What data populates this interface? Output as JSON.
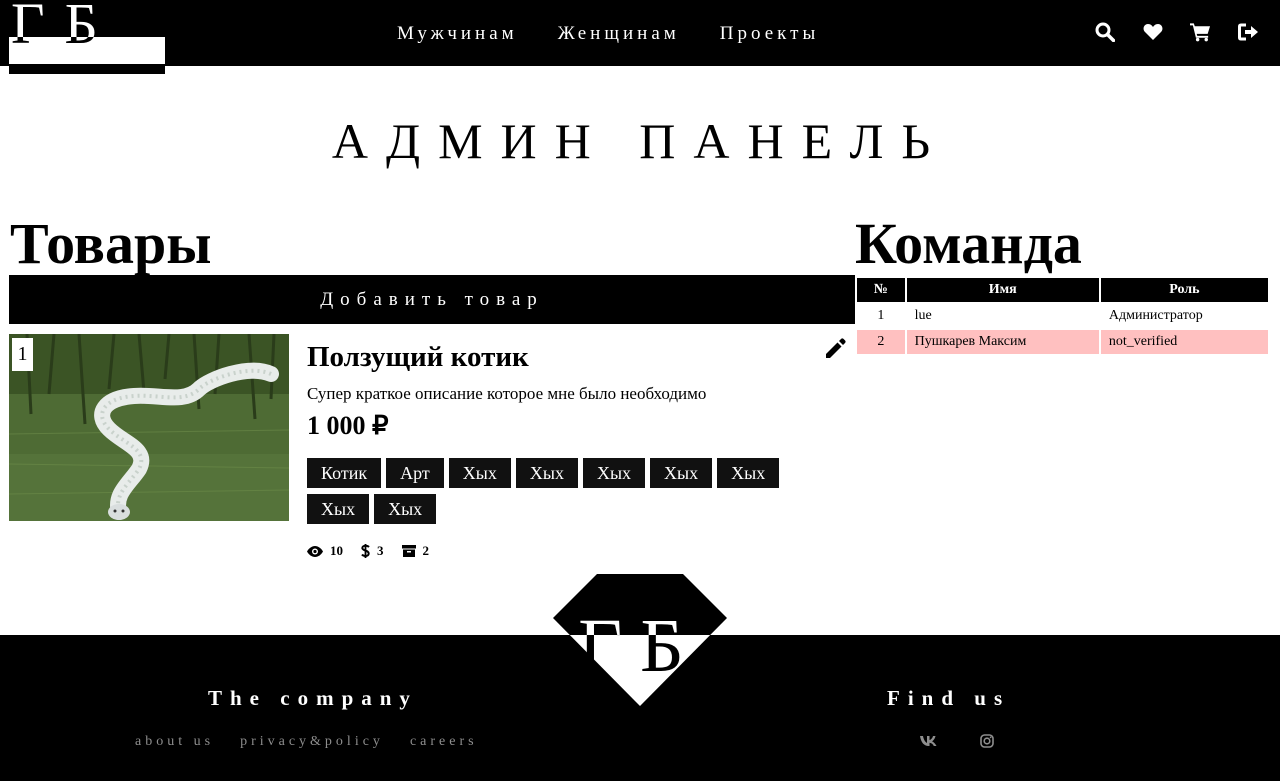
{
  "header": {
    "logo_text": "ГБ",
    "nav": [
      {
        "label": "Мужчинам"
      },
      {
        "label": "Женщинам"
      },
      {
        "label": "Проекты"
      }
    ],
    "icons": [
      "search-icon",
      "heart-icon",
      "cart-icon",
      "logout-icon"
    ]
  },
  "page": {
    "title": "АДМИН ПАНЕЛЬ"
  },
  "products": {
    "heading": "Товары",
    "add_button": "Добавить товар",
    "items": [
      {
        "index": "1",
        "name": "Ползущий котик",
        "description": "Супер краткое описание которое мне было необходимо",
        "price": "1 000 ₽",
        "tags": [
          "Котик",
          "Арт",
          "Хых",
          "Хых",
          "Хых",
          "Хых",
          "Хых",
          "Хых",
          "Хых"
        ],
        "stats": {
          "views": "10",
          "sales": "3",
          "stock": "2"
        }
      }
    ]
  },
  "team": {
    "heading": "Команда",
    "columns": [
      "№",
      "Имя",
      "Роль"
    ],
    "rows": [
      {
        "num": "1",
        "name": "lue",
        "role": "Администратор",
        "status": "normal"
      },
      {
        "num": "2",
        "name": "Пушкарев Максим",
        "role": "not_verified",
        "status": "unverified"
      }
    ],
    "colors": {
      "unverified_row": "#ffc0c0"
    }
  },
  "footer": {
    "logo_text": "ГБ",
    "company_heading": "The company",
    "links": [
      {
        "label": "about us"
      },
      {
        "label": "privacy&policy"
      },
      {
        "label": "careers"
      }
    ],
    "find_heading": "Find us",
    "social": [
      {
        "label": "vk",
        "icon": "vk-icon"
      },
      {
        "label": "",
        "icon": "instagram-icon"
      }
    ]
  },
  "colors": {
    "background": "#ffffff",
    "header_bg": "#000000",
    "footer_bg": "#000000",
    "footer_link": "#8e8e8e",
    "tag_bg": "#111111"
  }
}
